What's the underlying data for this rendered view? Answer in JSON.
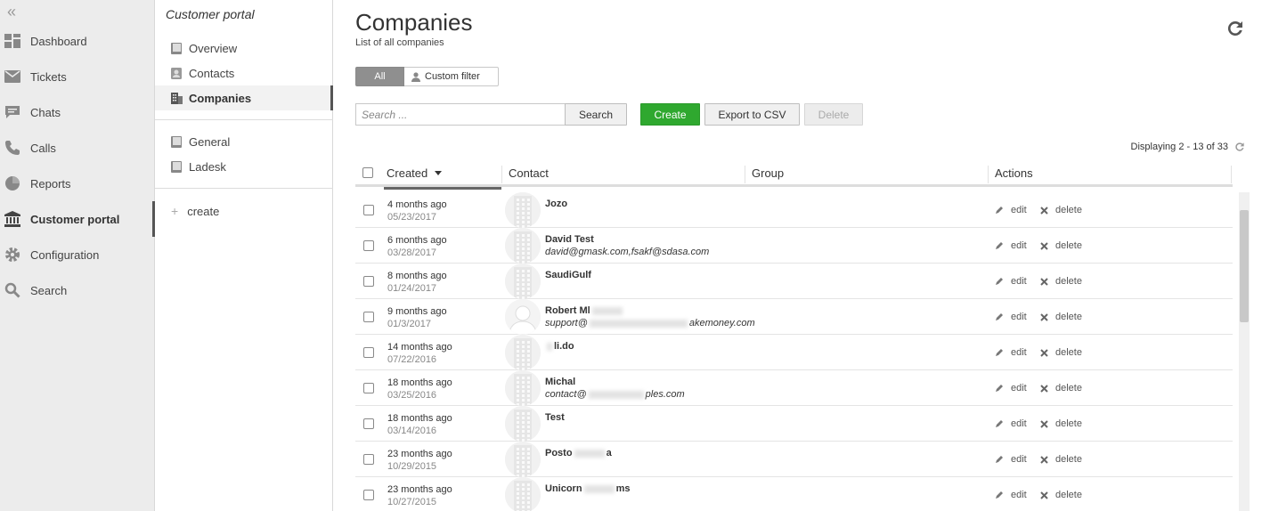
{
  "nav": {
    "items": [
      {
        "label": "Dashboard",
        "icon": "dashboard-icon",
        "active": false
      },
      {
        "label": "Tickets",
        "icon": "envelope-icon",
        "active": false
      },
      {
        "label": "Chats",
        "icon": "chat-icon",
        "active": false
      },
      {
        "label": "Calls",
        "icon": "phone-icon",
        "active": false
      },
      {
        "label": "Reports",
        "icon": "pie-chart-icon",
        "active": false
      },
      {
        "label": "Customer portal",
        "icon": "bank-icon",
        "active": true
      },
      {
        "label": "Configuration",
        "icon": "gear-icon",
        "active": false
      },
      {
        "label": "Search",
        "icon": "search-icon",
        "active": false
      }
    ]
  },
  "subnav": {
    "title": "Customer portal",
    "items": [
      {
        "label": "Overview",
        "icon": "book-icon",
        "active": false
      },
      {
        "label": "Contacts",
        "icon": "contacts-icon",
        "active": false
      },
      {
        "label": "Companies",
        "icon": "building-icon",
        "active": true
      }
    ],
    "kb_items": [
      {
        "label": "General",
        "icon": "book-icon"
      },
      {
        "label": "Ladesk",
        "icon": "book-icon"
      }
    ],
    "create_label": "create"
  },
  "main": {
    "title": "Companies",
    "subtitle": "List of all companies",
    "filter_all": "All",
    "filter_custom": "Custom filter",
    "search_placeholder": "Search ...",
    "search_button": "Search",
    "create_button": "Create",
    "export_button": "Export to CSV",
    "delete_button": "Delete",
    "displaying": "Displaying 2 - 13 of 33"
  },
  "table": {
    "columns": [
      "Created",
      "Contact",
      "Group",
      "Actions"
    ],
    "edit_label": "edit",
    "delete_label": "delete",
    "rows": [
      {
        "ago": "4 months ago",
        "date": "05/23/2017",
        "name": "Jozo",
        "email": "",
        "avatar": "building"
      },
      {
        "ago": "6 months ago",
        "date": "03/28/2017",
        "name": "David Test",
        "email": "david@gmask.com,fsakf@sdasa.com",
        "avatar": "building"
      },
      {
        "ago": "8 months ago",
        "date": "01/24/2017",
        "name": "SaudiGulf",
        "email": "",
        "avatar": "building"
      },
      {
        "ago": "9 months ago",
        "date": "01/3/2017",
        "name": "Robert Ml",
        "email": "support@",
        "email_tail": "akemoney.com",
        "avatar": "person"
      },
      {
        "ago": "14 months ago",
        "date": "07/22/2016",
        "name": "li.do",
        "email": "",
        "avatar": "building"
      },
      {
        "ago": "18 months ago",
        "date": "03/25/2016",
        "name": "Michal",
        "email": "contact@",
        "email_tail": "ples.com",
        "avatar": "building"
      },
      {
        "ago": "18 months ago",
        "date": "03/14/2016",
        "name": "Test",
        "email": "",
        "avatar": "building"
      },
      {
        "ago": "23 months ago",
        "date": "10/29/2015",
        "name": "Posto",
        "name_tail": "a",
        "email": "",
        "avatar": "building"
      },
      {
        "ago": "23 months ago",
        "date": "10/27/2015",
        "name": "Unicorn",
        "name_tail": "ms",
        "email": "",
        "avatar": "building"
      }
    ]
  }
}
